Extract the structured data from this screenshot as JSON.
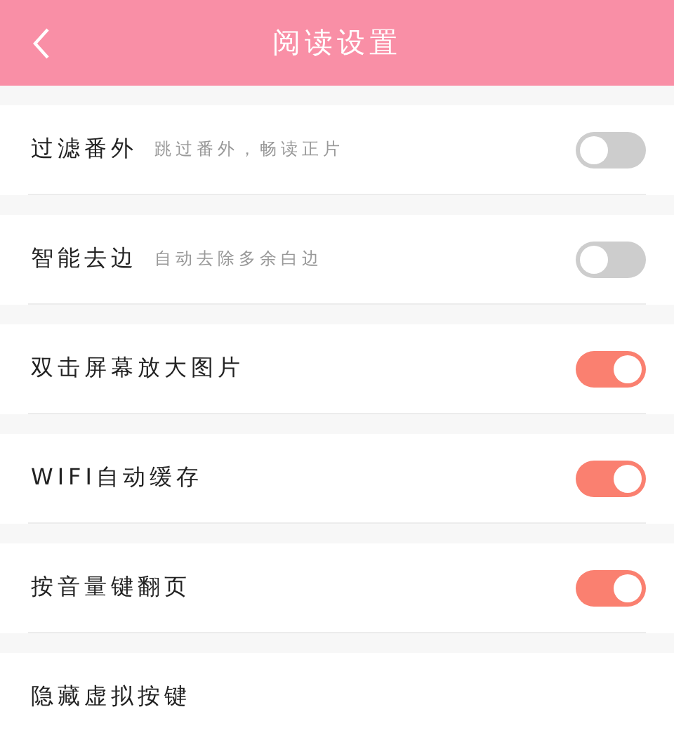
{
  "header": {
    "title": "阅读设置"
  },
  "settings": [
    {
      "label": "过滤番外",
      "description": "跳过番外，畅读正片",
      "on": false
    },
    {
      "label": "智能去边",
      "description": "自动去除多余白边",
      "on": false
    },
    {
      "label": "双击屏幕放大图片",
      "on": true
    },
    {
      "label": "WIFI自动缓存",
      "on": true
    },
    {
      "label": "按音量键翻页",
      "on": true
    },
    {
      "label": "隐藏虚拟按键"
    }
  ]
}
